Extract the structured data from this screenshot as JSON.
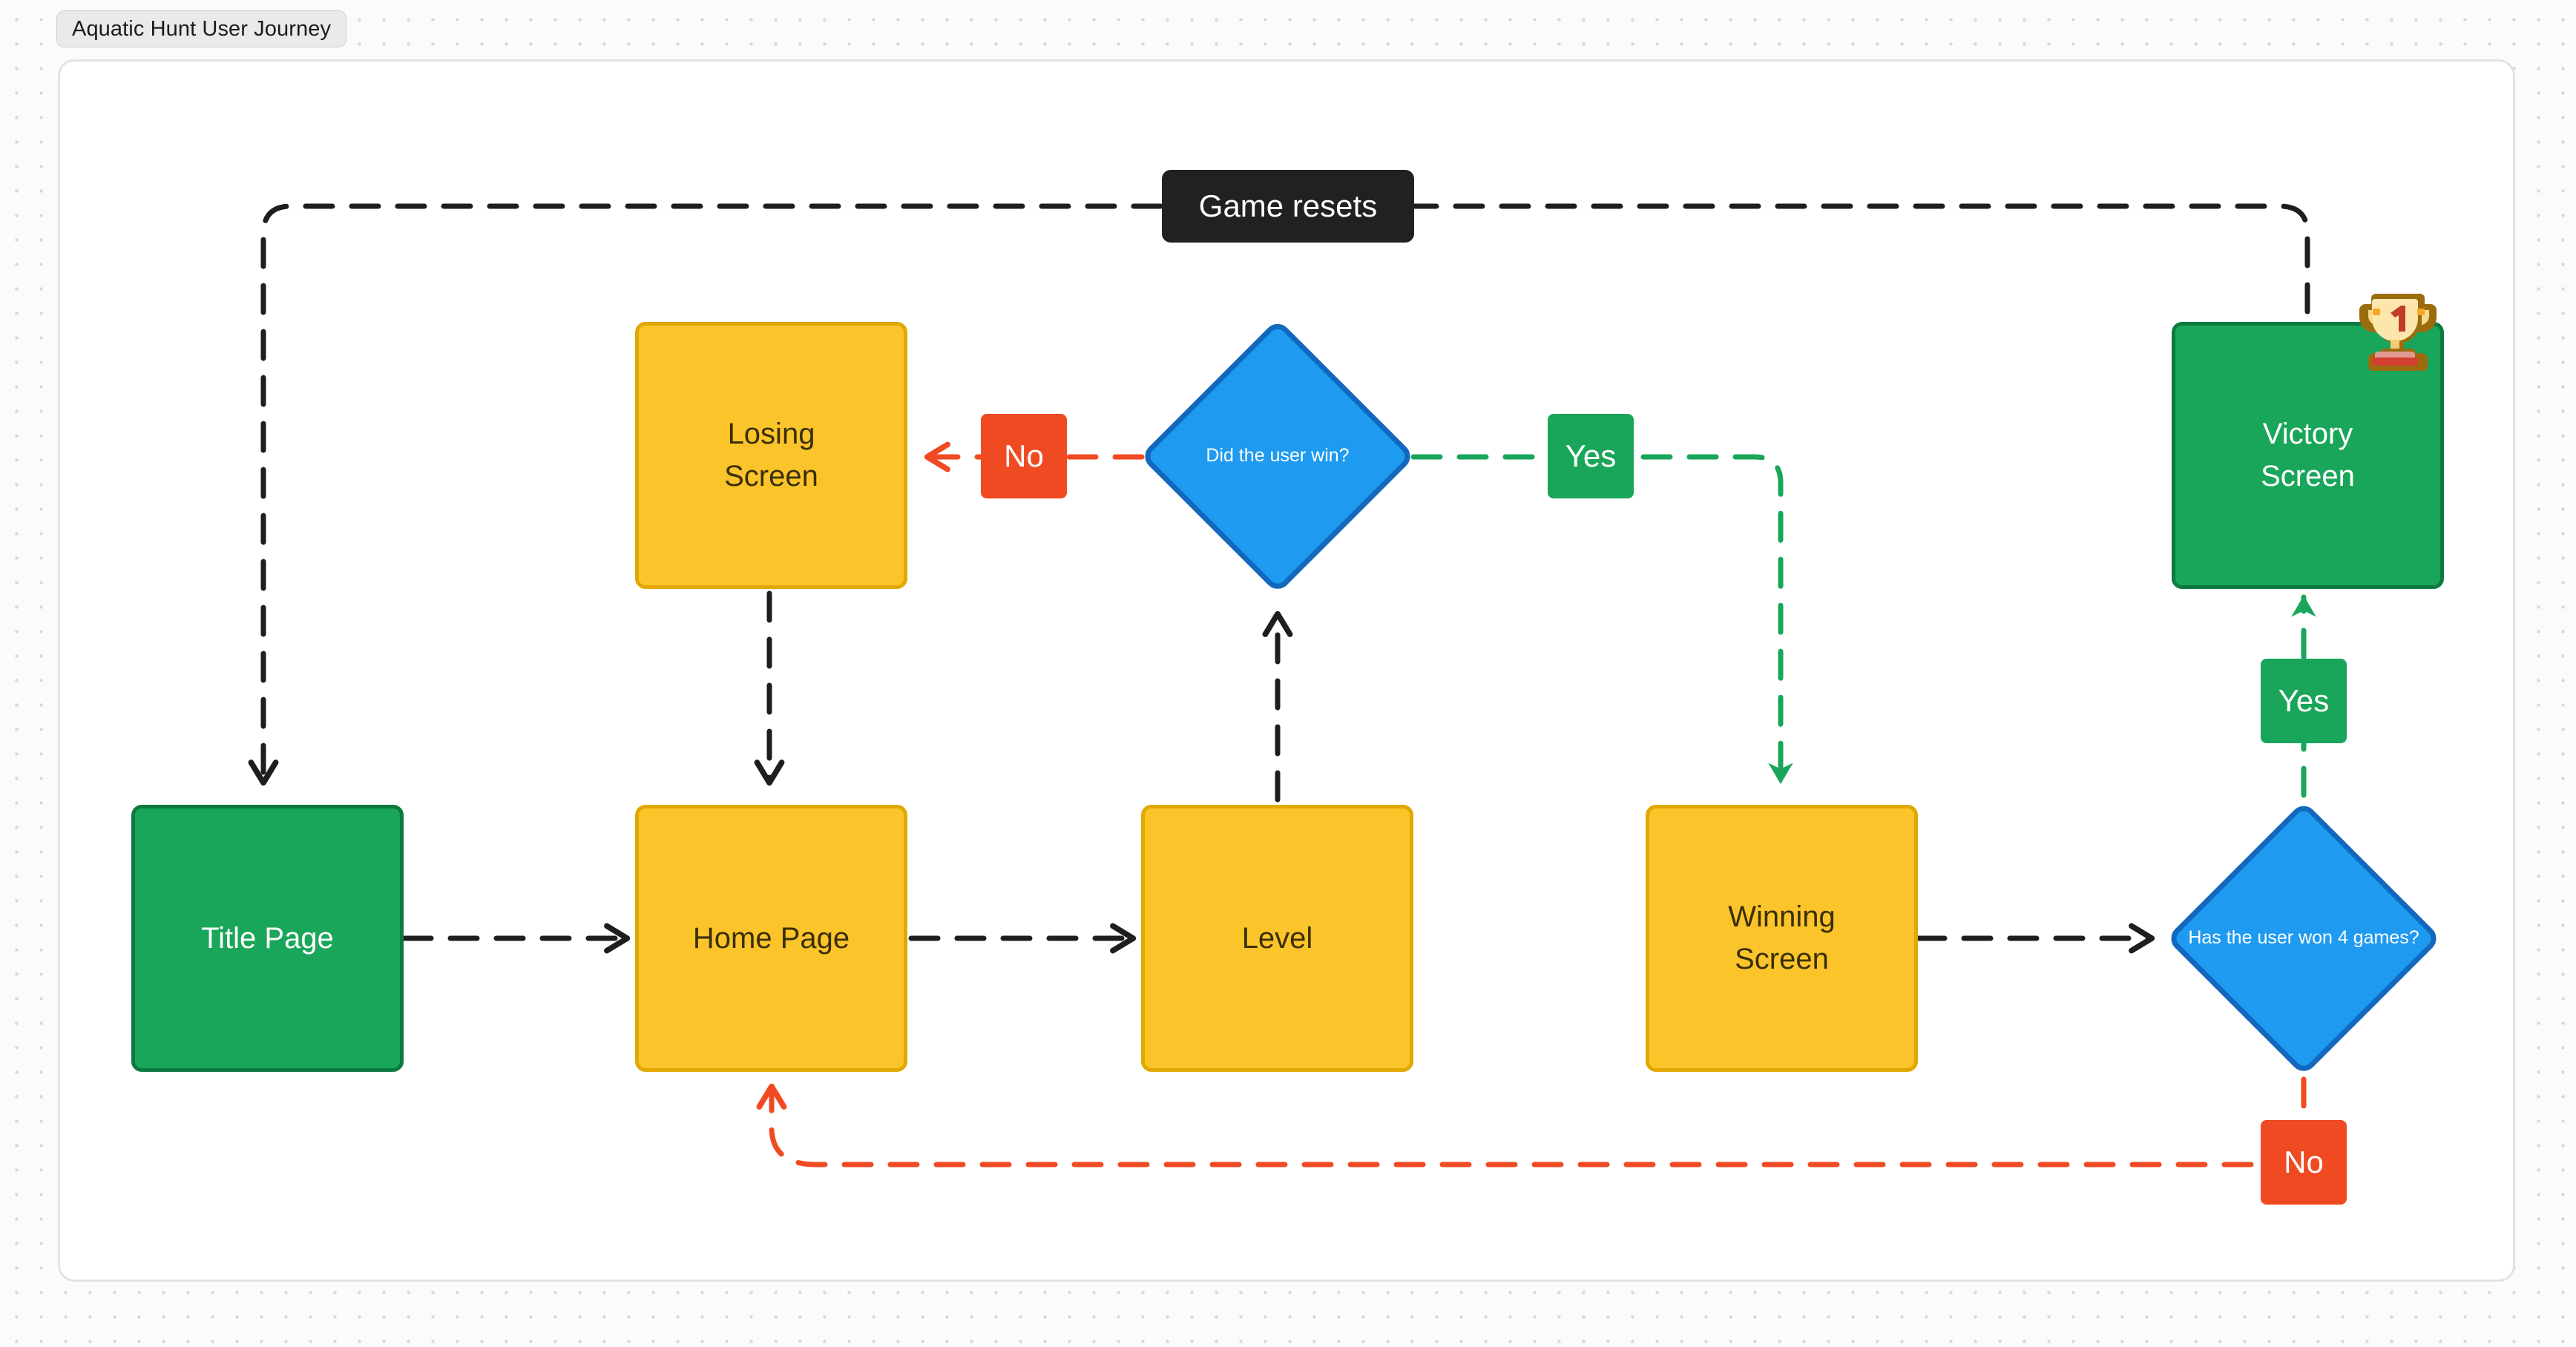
{
  "tab": {
    "label": "Aquatic Hunt User Journey"
  },
  "diagram": {
    "type": "flowchart",
    "nodes": [
      {
        "id": "title_page",
        "label_lines": [
          "Title Page"
        ],
        "shape": "rounded-rect",
        "color": "green"
      },
      {
        "id": "home_page",
        "label_lines": [
          "Home Page"
        ],
        "shape": "rounded-rect",
        "color": "yellow"
      },
      {
        "id": "level",
        "label_lines": [
          "Level"
        ],
        "shape": "rounded-rect",
        "color": "yellow"
      },
      {
        "id": "losing_screen",
        "label_lines": [
          "Losing",
          "Screen"
        ],
        "shape": "rounded-rect",
        "color": "yellow"
      },
      {
        "id": "winning_screen",
        "label_lines": [
          "Winning",
          "Screen"
        ],
        "shape": "rounded-rect",
        "color": "yellow"
      },
      {
        "id": "victory_screen",
        "label_lines": [
          "Victory",
          "Screen"
        ],
        "shape": "rounded-rect",
        "color": "green",
        "badge": "trophy-1-emoji"
      },
      {
        "id": "did_user_win",
        "label_lines": [
          "Did the",
          "user win?"
        ],
        "shape": "diamond",
        "color": "blue"
      },
      {
        "id": "won_4_games",
        "label_lines": [
          "Has the",
          "user won",
          "4 games?"
        ],
        "shape": "diamond",
        "color": "blue"
      }
    ],
    "edges": [
      {
        "id": "e_title_home",
        "from": "title_page",
        "to": "home_page",
        "label": "",
        "color": "black"
      },
      {
        "id": "e_home_level",
        "from": "home_page",
        "to": "level",
        "label": "",
        "color": "black"
      },
      {
        "id": "e_level_win",
        "from": "level",
        "to": "did_user_win",
        "label": "",
        "color": "black"
      },
      {
        "id": "e_win_no",
        "from": "did_user_win",
        "to": "losing_screen",
        "label": "No",
        "color": "red"
      },
      {
        "id": "e_win_yes",
        "from": "did_user_win",
        "to": "winning_screen",
        "label": "Yes",
        "color": "green"
      },
      {
        "id": "e_losing_home",
        "from": "losing_screen",
        "to": "home_page",
        "label": "",
        "color": "black"
      },
      {
        "id": "e_winning_check",
        "from": "winning_screen",
        "to": "won_4_games",
        "label": "",
        "color": "black"
      },
      {
        "id": "e_check_yes",
        "from": "won_4_games",
        "to": "victory_screen",
        "label": "Yes",
        "color": "green"
      },
      {
        "id": "e_check_no",
        "from": "won_4_games",
        "to": "home_page",
        "label": "No",
        "color": "red"
      },
      {
        "id": "e_victory_reset",
        "from": "victory_screen",
        "to": "title_page",
        "label": "Game resets",
        "color": "black"
      }
    ],
    "labels": {
      "game_resets": "Game resets",
      "no_lose": "No",
      "yes_win": "Yes",
      "yes_victory": "Yes",
      "no_replay": "No"
    },
    "colors": {
      "yellow_fill": "#fbc42b",
      "yellow_border": "#e0a800",
      "green_fill": "#1aa65a",
      "green_border": "#0c7a3e",
      "blue_fill": "#1e9af0",
      "blue_border": "#1268bd",
      "red_edge": "#f04a23",
      "green_edge": "#1aa65a",
      "black_edge": "#1e1e1e",
      "dark_label": "#212121",
      "canvas": "#ffffff"
    }
  }
}
